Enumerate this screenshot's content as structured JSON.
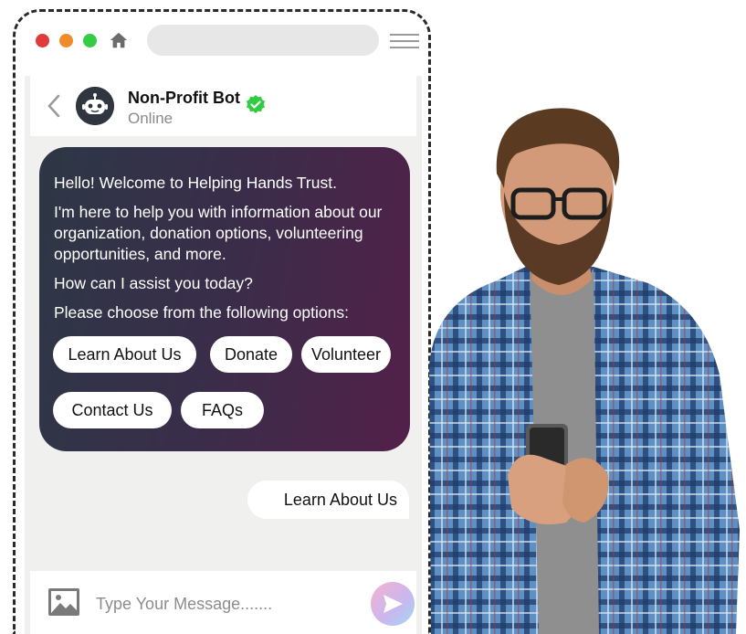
{
  "browser": {
    "traffic_lights": [
      "#e03a3a",
      "#f08a2a",
      "#33cc44"
    ],
    "icons": [
      "home-icon",
      "hamburger-menu-icon"
    ]
  },
  "chat": {
    "header": {
      "bot_name": "Non-Profit Bot",
      "status": "Online",
      "icons": [
        "back-chevron-icon",
        "robot-avatar",
        "verified-badge-icon"
      ]
    },
    "bot_message": {
      "lines": [
        "Hello! Welcome to Helping Hands Trust.",
        "I'm here to help you with information about our organization, donation options, volunteering opportunities, and more.",
        "How can I assist you today?",
        "Please choose from the following options:"
      ],
      "options": [
        "Learn About Us",
        "Donate",
        "Volunteer",
        "Contact Us",
        "FAQs"
      ],
      "gradient": [
        "#2d3746",
        "#53204a"
      ]
    },
    "user_message": "Learn About Us",
    "composer": {
      "placeholder": "Type Your Message.......",
      "icons": [
        "image-icon",
        "send-icon"
      ]
    }
  },
  "accent_verified": "#2ecc40"
}
